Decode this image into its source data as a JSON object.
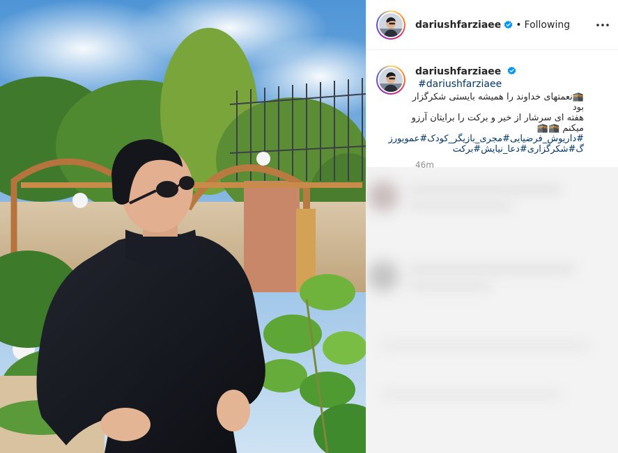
{
  "post": {
    "author": {
      "username": "dariushfarziaee",
      "verified": true
    },
    "follow_status": "Following",
    "separator": "•",
    "caption": {
      "hashtag_link": "#dariushfarziaee",
      "lines": [
        "🕋نعمتهای خداوند را همیشه بایستی شکرگزار بود",
        "هفته ای سرشار از خیر و برکت را برایتان آرزو",
        "میکنم 🕋🕋"
      ],
      "tag_lines": [
        "#داریوش_فرضیایی#مجری_بازیگر_کودک#عمویورز",
        "گ#شکرگزاری#دعا_نیایش#برکت"
      ]
    },
    "timestamp": "46m"
  },
  "icons": {
    "more": "more-horizontal-icon",
    "verified": "verified-badge-icon"
  },
  "colors": {
    "link": "#00376b",
    "verified": "#0095f6",
    "muted": "#8e8e8e",
    "border": "#efefef"
  }
}
